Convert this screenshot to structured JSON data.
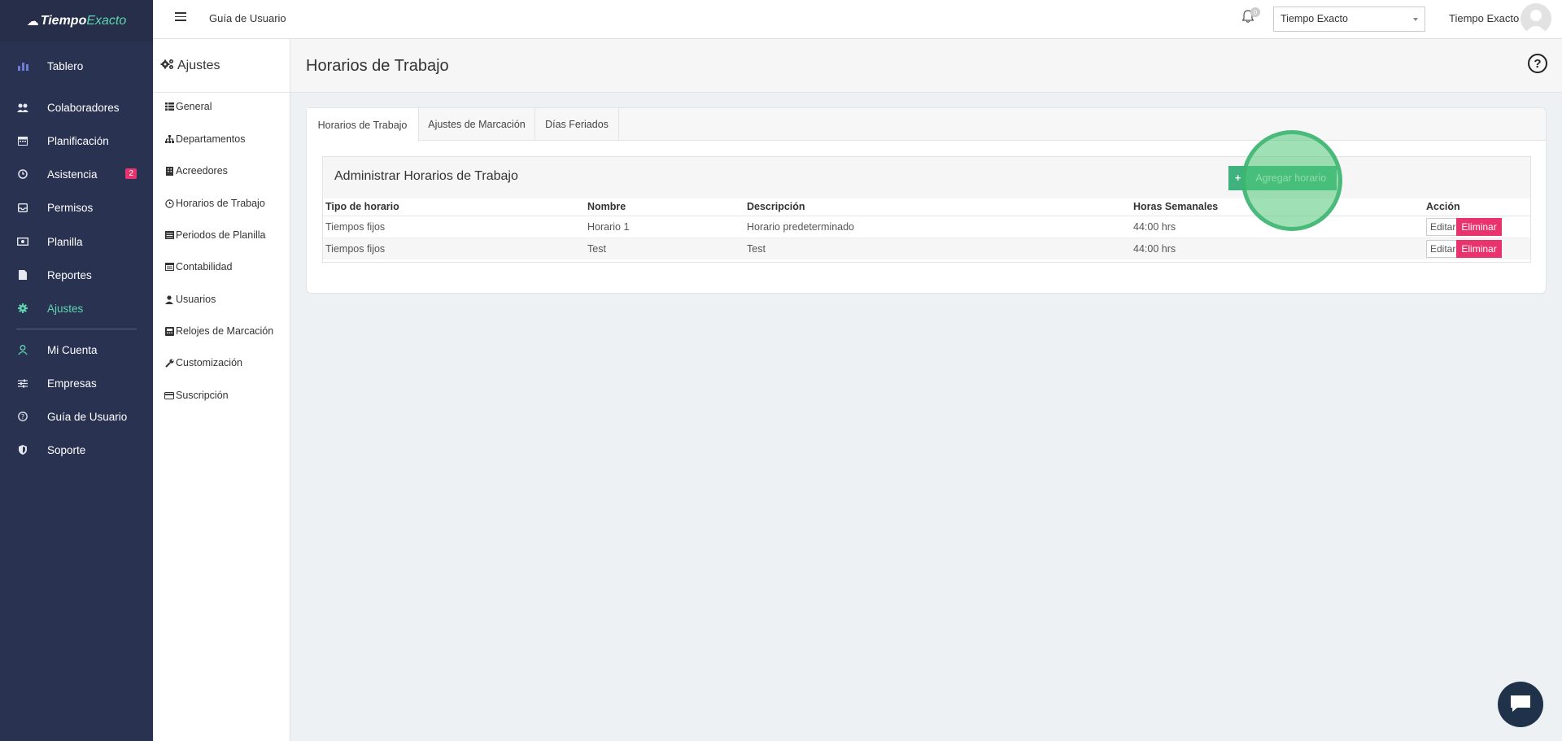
{
  "brand": {
    "name_part1": "Tiempo",
    "name_part2": "Exacto"
  },
  "nav": {
    "items": [
      {
        "label": "Tablero",
        "icon": "bar-chart-icon"
      },
      {
        "label": "Colaboradores",
        "icon": "users-icon"
      },
      {
        "label": "Planificación",
        "icon": "calendar-icon"
      },
      {
        "label": "Asistencia",
        "icon": "clock-icon",
        "badge": "2"
      },
      {
        "label": "Permisos",
        "icon": "inbox-icon"
      },
      {
        "label": "Planilla",
        "icon": "money-icon"
      },
      {
        "label": "Reportes",
        "icon": "file-icon"
      },
      {
        "label": "Ajustes",
        "icon": "gear-icon",
        "active": true
      },
      {
        "label": "Mi Cuenta",
        "icon": "user-icon"
      },
      {
        "label": "Empresas",
        "icon": "sliders-icon"
      },
      {
        "label": "Guía de Usuario",
        "icon": "question-icon"
      },
      {
        "label": "Soporte",
        "icon": "shield-icon"
      }
    ]
  },
  "topbar": {
    "guide_link": "Guía de Usuario",
    "notifications_count": "0",
    "company_selected": "Tiempo Exacto",
    "user_name": "Tiempo Exacto"
  },
  "settings_sidebar": {
    "title": "Ajustes",
    "items": [
      {
        "label": "General",
        "icon": "list-icon"
      },
      {
        "label": "Departamentos",
        "icon": "sitemap-icon"
      },
      {
        "label": "Acreedores",
        "icon": "building-icon"
      },
      {
        "label": "Horarios de Trabajo",
        "icon": "clock-icon"
      },
      {
        "label": "Periodos de Planilla",
        "icon": "calendar-list-icon"
      },
      {
        "label": "Contabilidad",
        "icon": "ledger-icon"
      },
      {
        "label": "Usuarios",
        "icon": "user-icon"
      },
      {
        "label": "Relojes de Marcación",
        "icon": "terminal-icon"
      },
      {
        "label": "Customización",
        "icon": "wrench-icon"
      },
      {
        "label": "Suscripción",
        "icon": "credit-card-icon"
      }
    ]
  },
  "page": {
    "title": "Horarios de Trabajo"
  },
  "tabs": [
    {
      "label": "Horarios de Trabajo",
      "active": true
    },
    {
      "label": "Ajustes de Marcación"
    },
    {
      "label": "Días Feriados"
    }
  ],
  "panel": {
    "title": "Administrar Horarios de Trabajo",
    "add_button": "Agregar horario"
  },
  "table": {
    "headers": [
      "Tipo de horario",
      "Nombre",
      "Descripción",
      "Horas Semanales",
      "Acción"
    ],
    "rows": [
      {
        "tipo": "Tiempos fijos",
        "nombre": "Horario 1",
        "descripcion": "Horario predeterminado",
        "horas": "44:00 hrs"
      },
      {
        "tipo": "Tiempos fijos",
        "nombre": "Test",
        "descripcion": "Test",
        "horas": "44:00 hrs"
      }
    ],
    "edit_label": "Editar",
    "delete_label": "Eliminar"
  },
  "colors": {
    "sidebar_bg": "#2a3252",
    "accent_green": "#3fb27f",
    "active_nav": "#5ed6b0",
    "danger": "#e8336f",
    "chat_bg": "#1f3249"
  }
}
